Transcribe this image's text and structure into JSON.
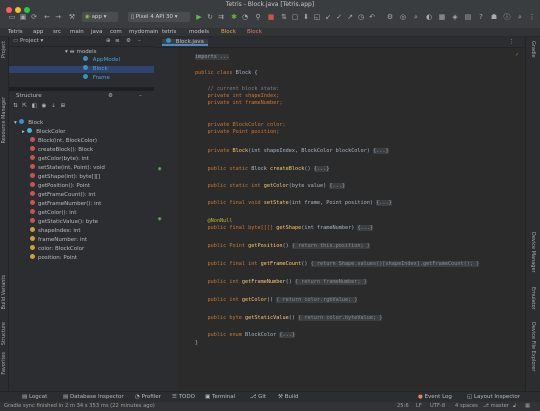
{
  "window": {
    "title": "Tetris - Block.java [Tetris.app]"
  },
  "toolbar": {
    "module": "app",
    "device": "Pixel 4 API 30",
    "colors": {
      "red": "#ff5f57",
      "yellow": "#febc2e",
      "green": "#28c840"
    }
  },
  "breadcrumbs": [
    "Tetris",
    "app",
    "src",
    "main",
    "java",
    "com",
    "mydomain",
    "tetris",
    "models",
    "Block",
    "Block"
  ],
  "project_panel": {
    "header": "Project",
    "items": [
      {
        "label": "models",
        "icon": "folder-icon"
      },
      {
        "label": "AppModel",
        "icon": "class-icon"
      },
      {
        "label": "Block",
        "icon": "class-icon"
      },
      {
        "label": "Frame",
        "icon": "class-icon"
      }
    ]
  },
  "structure_panel": {
    "header": "Structure",
    "items": [
      {
        "label": "Block",
        "icon": "class-icon"
      },
      {
        "label": "BlockColor",
        "icon": "enum-icon"
      },
      {
        "label": "Block(int, BlockColor)",
        "icon": "method-icon"
      },
      {
        "label": "createBlock(): Block",
        "icon": "method-icon"
      },
      {
        "label": "getColor(byte): int",
        "icon": "method-icon"
      },
      {
        "label": "setState(int, Point): void",
        "icon": "method-icon"
      },
      {
        "label": "getShape(int): byte[][]",
        "icon": "method-icon"
      },
      {
        "label": "getPosition(): Point",
        "icon": "method-icon"
      },
      {
        "label": "getFrameCount(): int",
        "icon": "method-icon"
      },
      {
        "label": "getFrameNumber(): int",
        "icon": "method-icon"
      },
      {
        "label": "getColor(): int",
        "icon": "method-icon"
      },
      {
        "label": "getStaticValue(): byte",
        "icon": "method-icon"
      },
      {
        "label": "shapeIndex: int",
        "icon": "field-icon"
      },
      {
        "label": "frameNumber: int",
        "icon": "field-icon"
      },
      {
        "label": "color: BlockColor",
        "icon": "field-icon"
      },
      {
        "label": "position: Point",
        "icon": "field-icon"
      }
    ]
  },
  "left_strip": [
    "Project",
    "Resource Manager",
    "Build Variants",
    "Structure",
    "Favorites"
  ],
  "editor_tabs": [
    "Block.java"
  ],
  "gutter_numbers": [
    "1",
    "2",
    "3",
    "4",
    "5",
    "6",
    "7",
    "8",
    "9",
    "10"
  ],
  "code": {
    "l1": "imports ...",
    "l2a": "public class ",
    "l2b": "Block {",
    "l3": "// current block state:",
    "l4": "private int shapeIndex;",
    "l5": "private int frameNumber;",
    "l6": "private BlockColor color;",
    "l7": "private Point position;",
    "l8a": "private ",
    "l8b": "Block",
    "l8c": "(int shapeIndex, BlockColor blockColor) ",
    "l8d": "{...}",
    "l9a": "public static ",
    "l9b": "Block ",
    "l9c": "createBlock",
    "l9d": "() ",
    "l9e": "{...}",
    "l10a": "public static int ",
    "l10b": "getColor",
    "l10c": "(byte value) ",
    "l10d": "{...}",
    "l11a": "public final void ",
    "l11b": "setState",
    "l11c": "(int frame, Point position) ",
    "l11d": "{...}",
    "l12": "@NonNull",
    "l13a": "public final byte[][] ",
    "l13b": "getShape",
    "l13c": "(int frameNumber) ",
    "l13d": "{...}",
    "l14a": "public Point ",
    "l14b": "getPosition",
    "l14c": "() ",
    "l14d": "{ return this.position; }",
    "l15a": "public final int ",
    "l15b": "getFrameCount",
    "l15c": "() ",
    "l15d": "{ return Shape.values()[shapeIndex].getFrameCount(); }",
    "l16a": "public int ",
    "l16b": "getFrameNumber",
    "l16c": "() ",
    "l16d": "{ return frameNumber; }",
    "l17a": "public int ",
    "l17b": "getColor",
    "l17c": "() ",
    "l17d": "{ return color.rgbValue; }",
    "l18a": "public byte ",
    "l18b": "getStaticValue",
    "l18c": "() ",
    "l18d": "{ return color.byteValue; }",
    "l19a": "public enum ",
    "l19b": "BlockColor ",
    "l19c": "{...}",
    "l20": "}"
  },
  "right_strip": [
    "Gradle",
    "Device Manager",
    "Emulator",
    "Device File Explorer"
  ],
  "bottom_tools": [
    "Logcat",
    "Database Inspector",
    "Profiler",
    "TODO",
    "Terminal",
    "Git",
    "Build",
    "Event Log",
    "Layout Inspector"
  ],
  "status": {
    "message": "Gradle sync finished in 2 m 34 s 353 ms (22 minutes ago)",
    "position": "25:6",
    "line_sep": "LF",
    "encoding": "UTF-8",
    "indent": "4 spaces",
    "branch": "master"
  }
}
